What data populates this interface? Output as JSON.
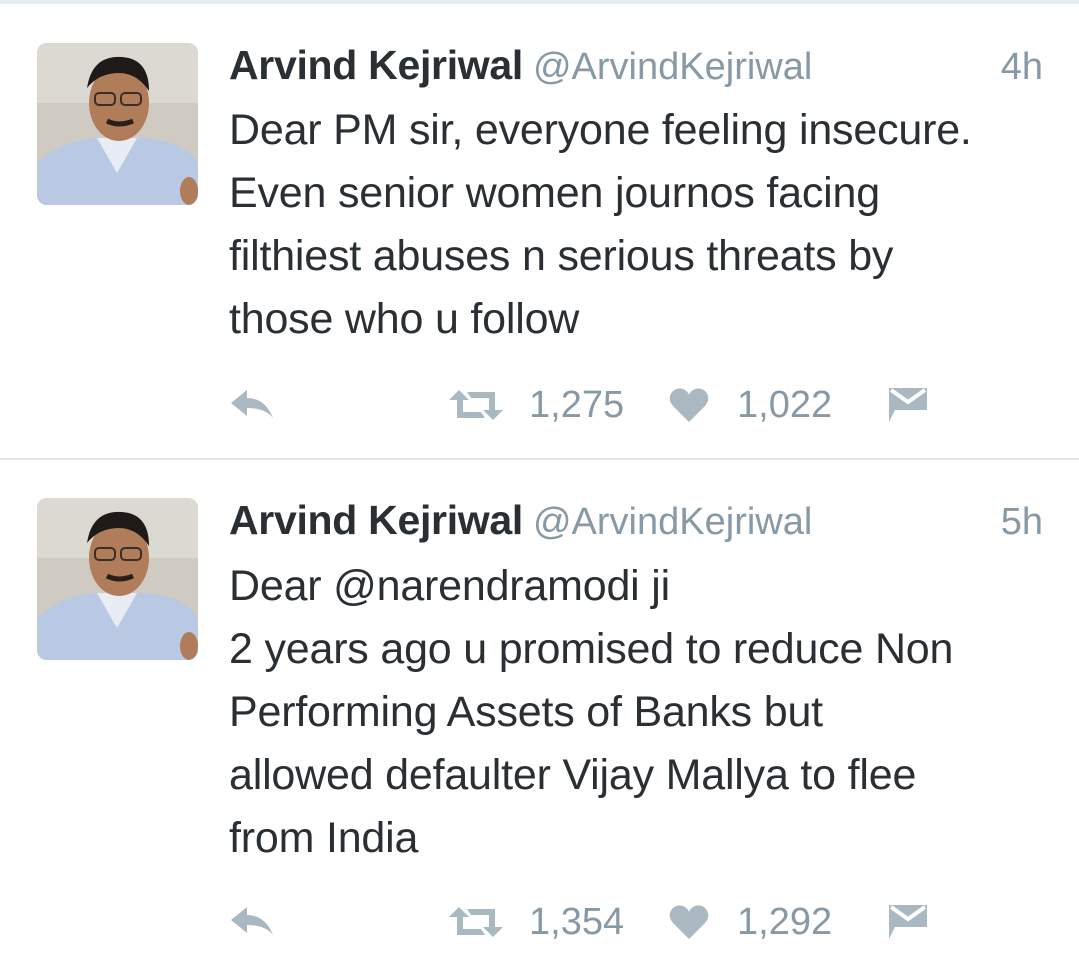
{
  "tweets": [
    {
      "name": "Arvind Kejriwal",
      "handle": "@ArvindKejriwal",
      "time": "4h",
      "lines": [
        "Dear PM sir, everyone feeling insecure.",
        "Even senior women journos facing",
        "filthiest abuses n serious threats by",
        "those who u follow"
      ],
      "retweets": "1,275",
      "likes": "1,022",
      "avatar_icon": "profile-photo",
      "actions_icons": [
        "reply-icon",
        "retweet-icon",
        "heart-icon",
        "message-icon"
      ]
    },
    {
      "name": "Arvind Kejriwal",
      "handle": "@ArvindKejriwal",
      "time": "5h",
      "lines": [
        "Dear @narendramodi ji",
        "2 years ago u promised to reduce Non",
        "Performing Assets of Banks but",
        "allowed defaulter Vijay Mallya to flee",
        "from India"
      ],
      "retweets": "1,354",
      "likes": "1,292",
      "avatar_icon": "profile-photo",
      "actions_icons": [
        "reply-icon",
        "retweet-icon",
        "heart-icon",
        "message-icon"
      ]
    }
  ],
  "colors": {
    "text": "#292f33",
    "muted": "#8899a6",
    "divider": "#e1e8ed",
    "icon": "#aab8c2"
  }
}
